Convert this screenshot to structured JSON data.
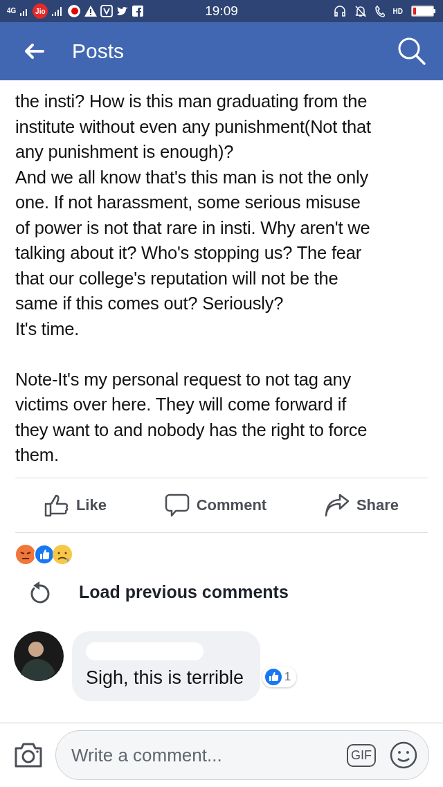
{
  "status_bar": {
    "network": "4G",
    "carrier": "Jio",
    "time": "19:09",
    "call_badge": "HD"
  },
  "app_bar": {
    "title": "Posts"
  },
  "post": {
    "paragraphs": [
      {
        "lines": [
          "the insti? How is this man graduating from the",
          "institute without even any punishment(Not that",
          "any punishment is enough)?"
        ]
      },
      {
        "lines": [
          "And we all know that's this man is not the only",
          "one. If not harassment, some serious misuse",
          "of power is not that rare in insti. Why aren't we",
          "talking about it? Who's stopping us? The fear",
          "that our college's reputation will not be the",
          "same if this comes out? Seriously?"
        ]
      },
      {
        "lines": [
          "It's time."
        ]
      },
      {
        "lines": [
          "Note-It's my personal request to not tag any",
          "victims over here. They will come forward if",
          "they want to and nobody has the right to force",
          "them."
        ],
        "gap_before": true
      }
    ]
  },
  "actions": [
    {
      "kind": "like",
      "label": "Like"
    },
    {
      "kind": "comment",
      "label": "Comment"
    },
    {
      "kind": "share",
      "label": "Share"
    }
  ],
  "load_previous": "Load previous comments",
  "comments": [
    {
      "text": "Sigh, this is terrible",
      "reaction_count": "1"
    }
  ],
  "composer": {
    "placeholder": "Write a comment...",
    "gif": "GIF"
  }
}
